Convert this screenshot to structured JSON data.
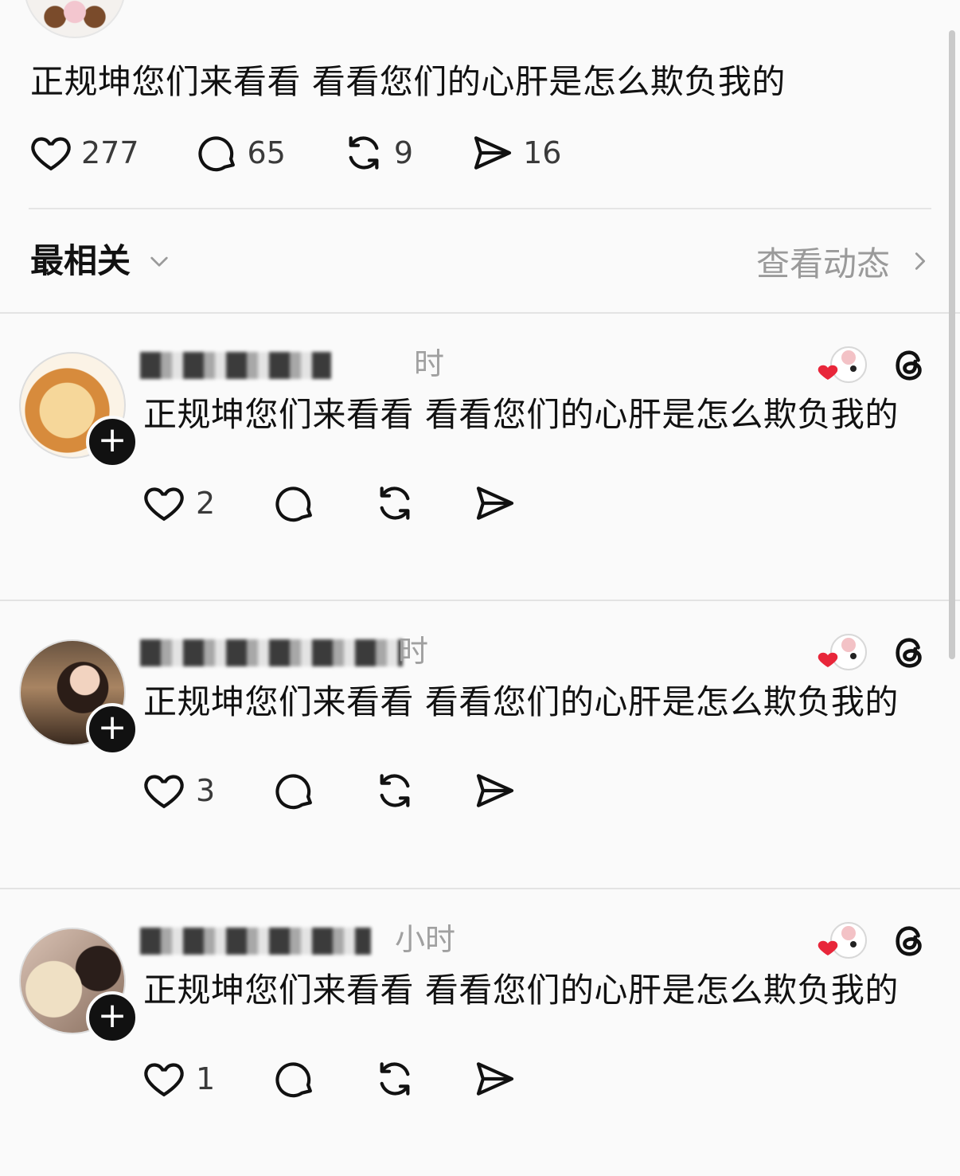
{
  "post": {
    "text": "正规坤您们来看看 看看您们的心肝是怎么欺负我的",
    "likes": "277",
    "comments": "65",
    "reposts": "9",
    "shares": "16"
  },
  "sort": {
    "label": "最相关",
    "activity_label": "查看动态"
  },
  "replies": [
    {
      "time": "时",
      "text": "正规坤您们来看看 看看您们的心肝是怎么欺负我的",
      "likes": "2"
    },
    {
      "time": "时",
      "text": "正规坤您们来看看 看看您们的心肝是怎么欺负我的",
      "likes": "3"
    },
    {
      "time": "小时",
      "text": "正规坤您们来看看 看看您们的心肝是怎么欺负我的",
      "likes": "1"
    }
  ],
  "icons": {
    "like": "heart-icon",
    "comment": "comment-icon",
    "repost": "repost-icon",
    "share": "share-icon",
    "threads": "threads-icon",
    "chevron_down": "chevron-down-icon",
    "chevron_right": "chevron-right-icon"
  },
  "colors": {
    "heart_red": "#e8263a",
    "text": "#111111",
    "muted": "#9a9a9a"
  }
}
